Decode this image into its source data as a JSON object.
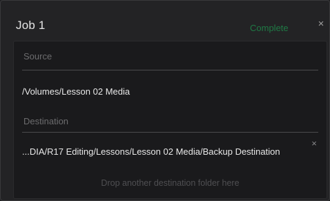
{
  "job": {
    "title": "Job 1",
    "status": "Complete",
    "close_glyph": "×"
  },
  "source": {
    "label": "Source",
    "path": "/Volumes/Lesson 02 Media"
  },
  "destination": {
    "label": "Destination",
    "path": "...DIA/R17 Editing/Lessons/Lesson 02 Media/Backup Destination",
    "remove_glyph": "×"
  },
  "drop_hint": "Drop another destination folder here",
  "colors": {
    "status_complete": "#1f7a45",
    "panel_bg": "#232325",
    "inner_bg": "#1a1a1c"
  },
  "icons": {
    "job_close": "close-icon",
    "destination_remove": "close-icon"
  }
}
